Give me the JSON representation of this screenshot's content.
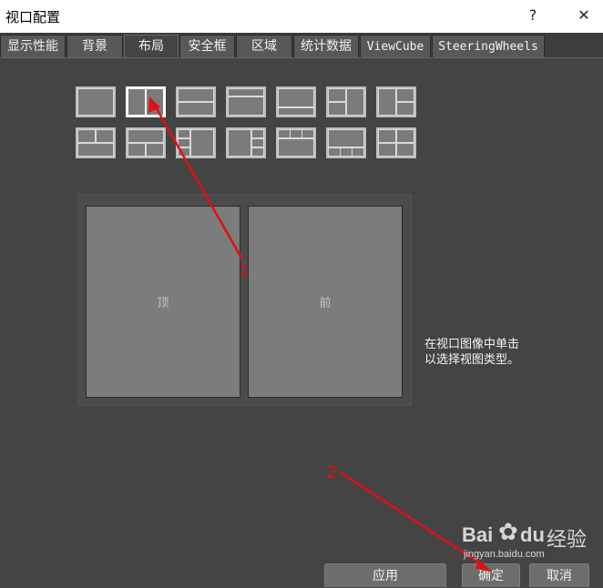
{
  "window": {
    "title": "视口配置",
    "help_glyph": "?",
    "close_glyph": "✕"
  },
  "tabs": [
    {
      "label": "显示性能"
    },
    {
      "label": "背景"
    },
    {
      "label": "布局",
      "active": true
    },
    {
      "label": "安全框"
    },
    {
      "label": "区域"
    },
    {
      "label": "统计数据"
    },
    {
      "label": "ViewCube"
    },
    {
      "label": "SteeringWheels"
    }
  ],
  "layouts": {
    "count": 14,
    "selected_index": 2
  },
  "preview": {
    "left_viewport": "顶",
    "right_viewport": "前"
  },
  "hint": "在视口图像中单击以选择视图类型。",
  "buttons": {
    "apply": "应用",
    "ok": "确定",
    "cancel": "取消"
  },
  "annotations": {
    "marker_1": "1",
    "marker_2": "2",
    "color": "#e01010"
  },
  "watermark": {
    "brand": "Bai",
    "brand2": "du",
    "suffix": "经验",
    "url": "jingyan.baidu.com"
  }
}
